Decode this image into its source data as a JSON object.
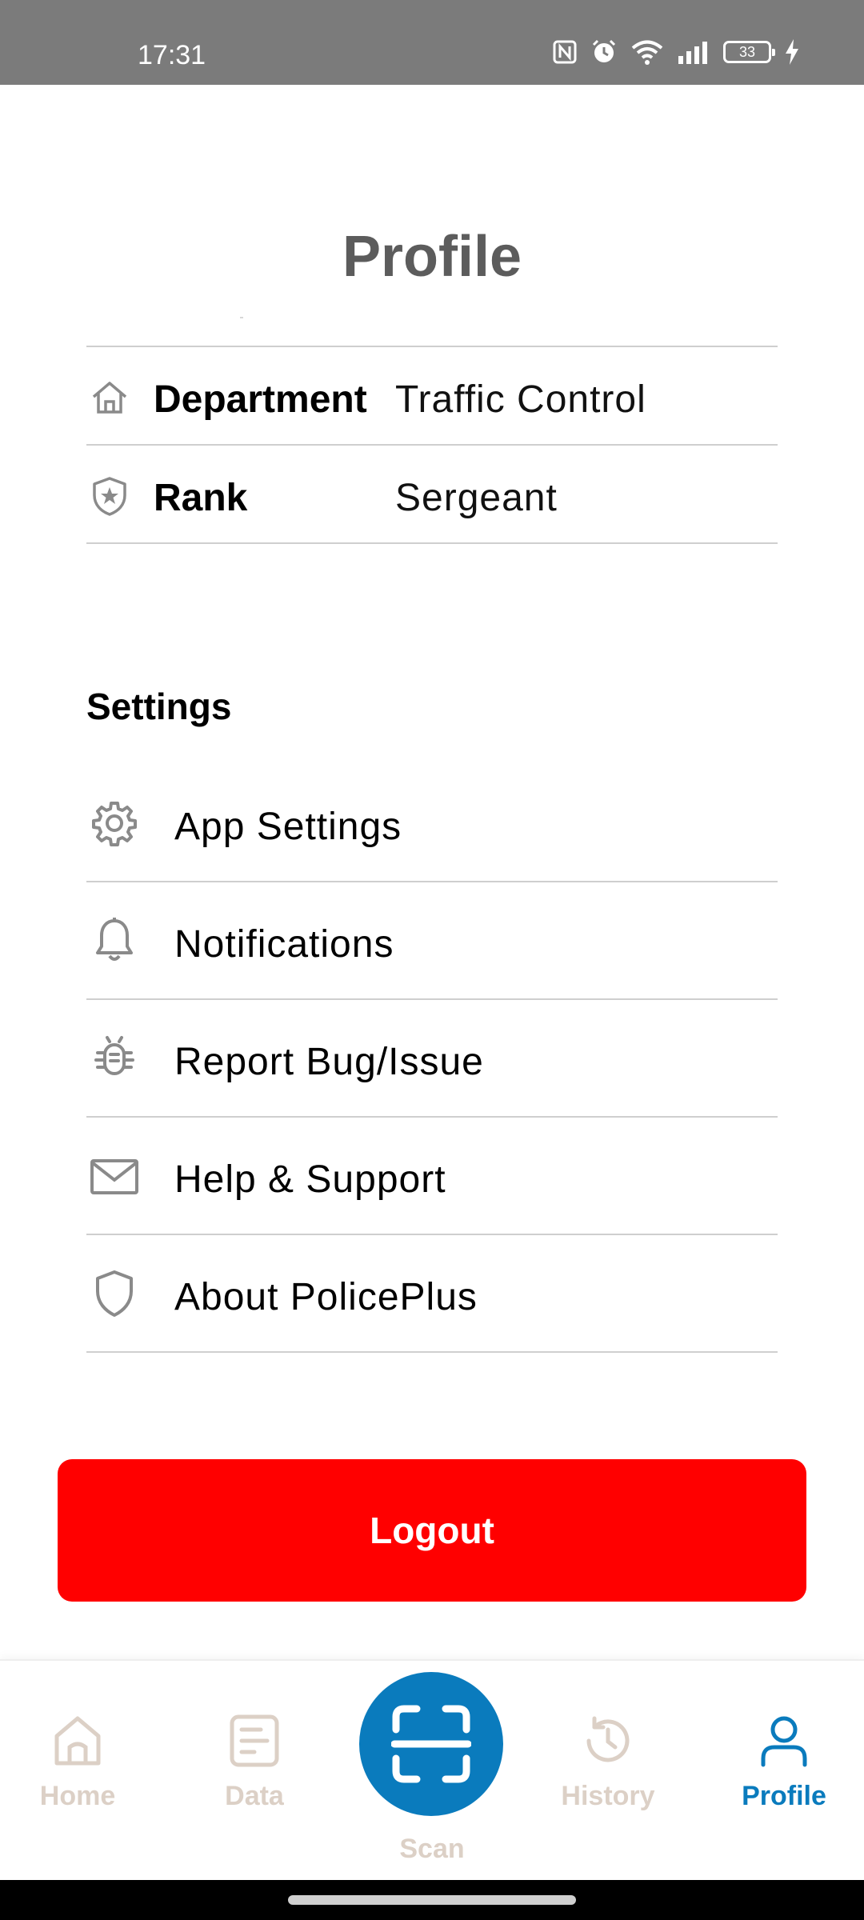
{
  "status_bar": {
    "time": "17:31",
    "battery": "33",
    "icons": [
      "nfc-icon",
      "alarm-icon",
      "wifi-icon",
      "signal-icon",
      "battery-icon",
      "charging-icon"
    ]
  },
  "page": {
    "title": "Profile"
  },
  "profile_info": [
    {
      "icon": "building-icon",
      "label": "Department",
      "value": "Traffic Control"
    },
    {
      "icon": "badge-shield-icon",
      "label": "Rank",
      "value": "Sergeant"
    }
  ],
  "settings": {
    "title": "Settings",
    "items": [
      {
        "icon": "gear-icon",
        "label": "App Settings"
      },
      {
        "icon": "bell-icon",
        "label": "Notifications"
      },
      {
        "icon": "bug-icon",
        "label": "Report Bug/Issue"
      },
      {
        "icon": "mail-icon",
        "label": "Help & Support"
      },
      {
        "icon": "shield-icon",
        "label": "About PolicePlus"
      }
    ]
  },
  "logout": {
    "label": "Logout",
    "color": "#ff0000"
  },
  "bottom_nav": {
    "items": [
      {
        "icon": "home-icon",
        "label": "Home",
        "active": false
      },
      {
        "icon": "document-icon",
        "label": "Data",
        "active": false
      },
      {
        "icon": "scan-icon",
        "label": "Scan",
        "active": false
      },
      {
        "icon": "history-icon",
        "label": "History",
        "active": false
      },
      {
        "icon": "user-icon",
        "label": "Profile",
        "active": true
      }
    ],
    "active_color": "#0a7bbd",
    "inactive_color": "#dcd0c6"
  }
}
